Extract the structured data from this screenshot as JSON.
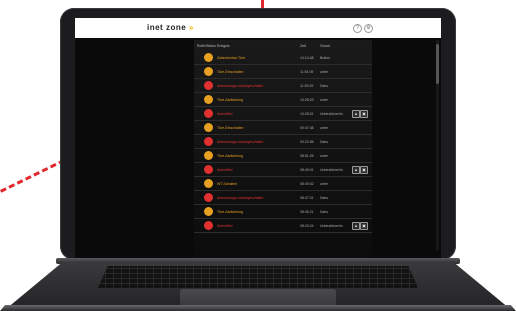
{
  "app": {
    "logo_text": "inet zone",
    "logo_accent": "»"
  },
  "top_icons": [
    "?",
    "⚙"
  ],
  "table": {
    "columns": [
      "Rolle/Status",
      "Ereignis",
      "Zeit",
      "Grund"
    ],
    "rows": [
      {
        "event": "Zwischenbar-Türe",
        "time": "14:14:48",
        "reason": "Button",
        "icon": "lock-icon",
        "color": "#e8a020",
        "buttons": false
      },
      {
        "event": "Türe-Einschalten",
        "time": "11:51:09",
        "reason": "unter",
        "icon": "lock-icon",
        "color": "#e8a020",
        "buttons": false
      },
      {
        "event": "Alarmanlage-scharfgeschaltet",
        "time": "11:29:29",
        "reason": "Sabu",
        "icon": "alarm-icon",
        "color": "#e03030",
        "buttons": false
      },
      {
        "event": "Türe-Abdichtung",
        "time": "10:28:03",
        "reason": "unter",
        "icon": "lock-icon",
        "color": "#e8a020",
        "buttons": false
      },
      {
        "event": "Alarmfilter",
        "time": "10:28:01",
        "reason": "Unterstützer/in",
        "icon": "car-icon",
        "color": "#e03030",
        "buttons": true
      },
      {
        "event": "Türe-Einschalten",
        "time": "09:47:38",
        "reason": "unter",
        "icon": "lock-icon",
        "color": "#e8a020",
        "buttons": false
      },
      {
        "event": "Alarmanlage-scharfgeschaltet",
        "time": "09:22:56",
        "reason": "Sabu",
        "icon": "alarm-icon",
        "color": "#e03030",
        "buttons": false
      },
      {
        "event": "Türe-Abdichtung",
        "time": "08:51:26",
        "reason": "unter",
        "icon": "lock-icon",
        "color": "#e8a020",
        "buttons": false
      },
      {
        "event": "Alarmfilter",
        "time": "08:49:01",
        "reason": "Unterstützer/in",
        "icon": "car-icon",
        "color": "#e03030",
        "buttons": true
      },
      {
        "event": "WT-Schalten",
        "time": "08:49:02",
        "reason": "unter",
        "icon": "lock-icon",
        "color": "#e8a020",
        "buttons": false
      },
      {
        "event": "Alarmanlage-scharfgeschaltet",
        "time": "08:47:31",
        "reason": "Sabu",
        "icon": "alarm-icon",
        "color": "#e03030",
        "buttons": false
      },
      {
        "event": "Türe-Abdichtung",
        "time": "08:45:21",
        "reason": "Sabu",
        "icon": "lock-icon",
        "color": "#e8a020",
        "buttons": false
      },
      {
        "event": "Alarmfilter",
        "time": "08:43:24",
        "reason": "Unterstützer/in",
        "icon": "car-icon",
        "color": "#e03030",
        "buttons": true
      }
    ]
  },
  "colors": {
    "accent": "#e03030",
    "amber": "#e8a020",
    "dash": "#e0282e"
  }
}
